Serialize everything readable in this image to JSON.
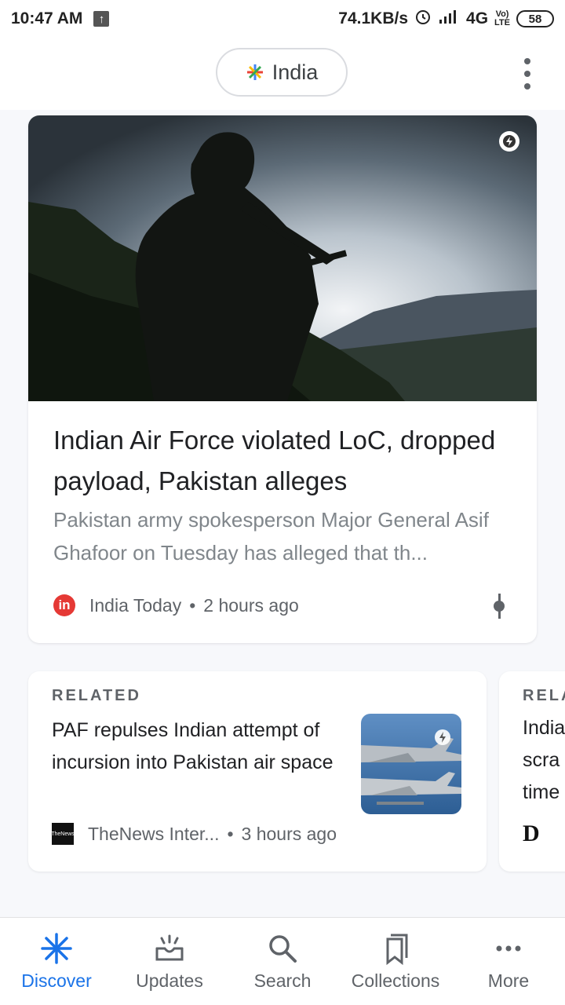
{
  "status_bar": {
    "time": "10:47 AM",
    "net_speed": "74.1KB/s",
    "network": "4G",
    "volte_top": "Vo)",
    "volte_bottom": "LTE",
    "battery": "58"
  },
  "header": {
    "location_label": "India"
  },
  "main_story": {
    "title": "Indian Air Force violated LoC, dropped payload, Pakistan alleges",
    "snippet": "Pakistan army spokesperson Major General Asif Ghafoor on Tuesday has alleged that th...",
    "source_logo_text": "in",
    "source": "India Today",
    "separator": "•",
    "time": "2 hours ago"
  },
  "related": {
    "label": "RELATED",
    "title": "PAF repulses Indian attempt of incursion into Pakistan air space",
    "source": "TheNews Inter...",
    "separator": "•",
    "time": "3 hours ago",
    "logo_text": "TheNews"
  },
  "related_peek": {
    "label": "RELA",
    "lines": [
      "India",
      "scra",
      "time"
    ],
    "logo_letter": "D"
  },
  "bottom_nav": {
    "items": [
      {
        "label": "Discover",
        "icon": "discover-icon",
        "active": true
      },
      {
        "label": "Updates",
        "icon": "updates-icon",
        "active": false
      },
      {
        "label": "Search",
        "icon": "search-icon",
        "active": false
      },
      {
        "label": "Collections",
        "icon": "collections-icon",
        "active": false
      },
      {
        "label": "More",
        "icon": "more-icon",
        "active": false
      }
    ]
  },
  "colors": {
    "accent": "#1a73e8",
    "source_logo": "#e53935",
    "text_primary": "#202124",
    "text_secondary": "#80868b"
  }
}
